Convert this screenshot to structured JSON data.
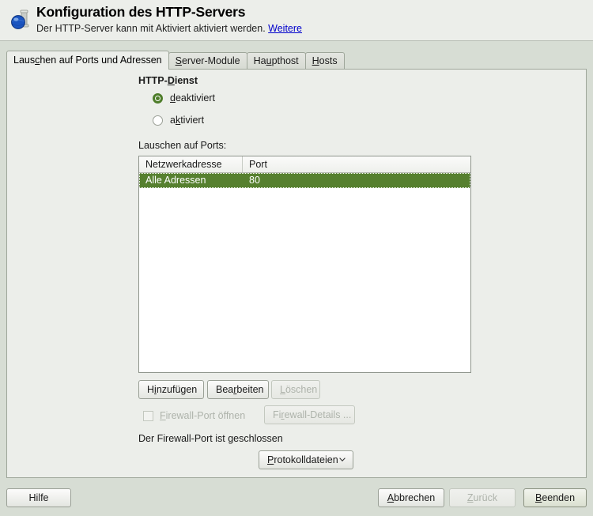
{
  "window": {
    "header": {
      "icon": "globe-pillar-icon",
      "title": "Konfiguration des HTTP-Servers",
      "subtitle_before": "Der HTTP-Server kann mit Aktiviert aktiviert werden.",
      "link_label": "Weitere"
    }
  },
  "tabs": [
    {
      "label": "Lauschen auf Ports und Adressen",
      "mnemonic": "c",
      "active": true
    },
    {
      "label": "Server-Module",
      "mnemonic": "S",
      "active": false
    },
    {
      "label": "Haupthost",
      "mnemonic": "u",
      "active": false
    },
    {
      "label": "Hosts",
      "mnemonic": "H",
      "active": false
    }
  ],
  "main": {
    "service_group_label": "HTTP-Dienst",
    "radios": [
      {
        "label": "deaktiviert",
        "mnemonic": "d",
        "checked": true
      },
      {
        "label": "aktiviert",
        "mnemonic": "k",
        "checked": false
      }
    ],
    "table_label": "Lauschen auf Ports:",
    "table": {
      "columns": [
        "Netzwerkadresse",
        "Port"
      ],
      "rows": [
        {
          "cells": [
            "Alle Adressen",
            "80"
          ],
          "selected": true
        }
      ]
    },
    "table_buttons": [
      {
        "label": "Hinzufügen",
        "mnemonic": "i",
        "enabled": true
      },
      {
        "label": "Bearbeiten",
        "mnemonic": "r",
        "enabled": true
      },
      {
        "label": "Löschen",
        "mnemonic": "L",
        "enabled": false
      }
    ],
    "firewall": {
      "checkbox_label": "Firewall-Port öffnen",
      "checkbox_mnemonic": "F",
      "checkbox_checked": false,
      "checkbox_enabled": false,
      "details_button_label": "Firewall-Details ...",
      "details_button_mnemonic": "r",
      "details_button_enabled": false,
      "status_text": "Der Firewall-Port ist geschlossen"
    },
    "log_dropdown": {
      "label": "Protokolldateien",
      "mnemonic": "P",
      "icon": "chevron-down-icon"
    }
  },
  "footer": {
    "help_label": "Hilfe",
    "cancel_label": "Abbrechen",
    "cancel_mnemonic": "A",
    "back_label": "Zurück",
    "back_mnemonic": "Z",
    "back_enabled": false,
    "finish_label": "Beenden",
    "finish_mnemonic": "B",
    "finish_default": true
  },
  "colors": {
    "selection_green": "#56802f",
    "radio_green": "#4e7d2a",
    "link_blue": "#0000cc",
    "window_bg": "#d7ddd4",
    "panel_bg": "#eceeea"
  }
}
